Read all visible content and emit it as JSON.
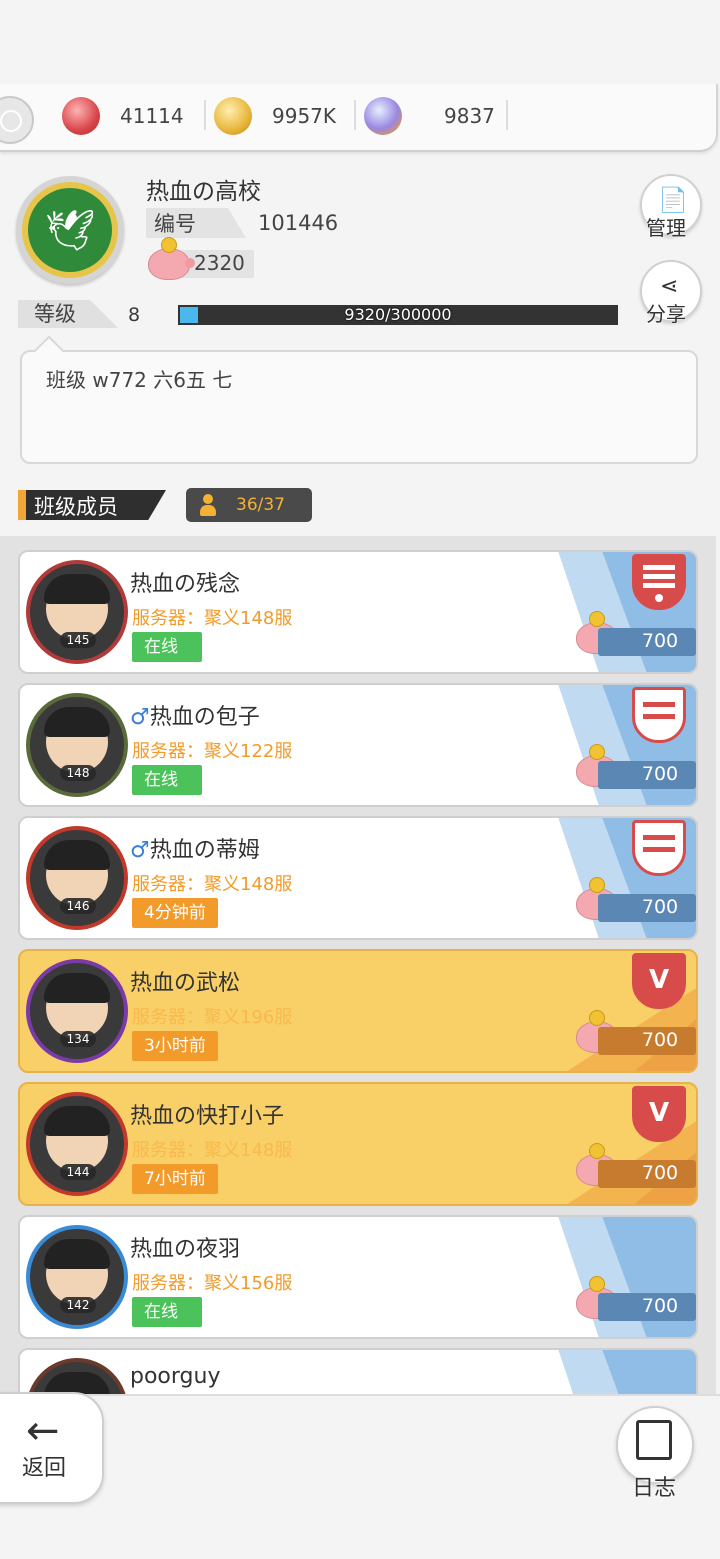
{
  "resources": [
    {
      "icon": "ruby-medal-icon",
      "value": "41114",
      "color": "#e0575a"
    },
    {
      "icon": "gold-coin-icon",
      "value": "9957K",
      "color": "#e8b53a"
    },
    {
      "icon": "crystal-pacifier-icon",
      "value": "9837",
      "color": "#9a86e2"
    }
  ],
  "guild": {
    "name": "热血の高校",
    "id_label": "编号",
    "id": "101446",
    "coins": "2320",
    "level_label": "等级",
    "level": "8",
    "exp_text": "9320/300000",
    "exp_current": 9320,
    "exp_max": 300000,
    "notice": "班级   w772  六6五 七"
  },
  "buttons": {
    "manage": "管理",
    "share": "分享",
    "back": "返回",
    "log": "日志"
  },
  "members_section": {
    "title": "班级成员",
    "count": "36/37"
  },
  "members": [
    {
      "name": "热血の残念",
      "male": "",
      "server": "服务器：聚义148服",
      "status": "在线",
      "status_type": "online",
      "level": "145",
      "coins": "700",
      "badge": "leader",
      "gold": false
    },
    {
      "name": "热血の包子",
      "male": "♂",
      "server": "服务器：聚义122服",
      "status": "在线",
      "status_type": "online",
      "level": "148",
      "coins": "700",
      "badge": "elder",
      "gold": false
    },
    {
      "name": "热血の蒂姆",
      "male": "♂",
      "server": "服务器：聚义148服",
      "status": "4分钟前",
      "status_type": "away",
      "level": "146",
      "coins": "700",
      "badge": "elder",
      "gold": false
    },
    {
      "name": "热血の武松",
      "male": "",
      "server": "服务器：聚义196服",
      "status": "3小时前",
      "status_type": "away",
      "level": "134",
      "coins": "700",
      "badge": "elite",
      "gold": true
    },
    {
      "name": "热血の快打小子",
      "male": "",
      "server": "服务器：聚义148服",
      "status": "7小时前",
      "status_type": "away",
      "level": "144",
      "coins": "700",
      "badge": "elite",
      "gold": true
    },
    {
      "name": "热血の夜羽",
      "male": "",
      "server": "服务器：聚义156服",
      "status": "在线",
      "status_type": "online",
      "level": "142",
      "coins": "700",
      "badge": "none",
      "gold": false
    },
    {
      "name": "poorguy",
      "male": "",
      "server": "",
      "status": "",
      "status_type": "none",
      "level": "",
      "coins": "",
      "badge": "none",
      "gold": false
    }
  ]
}
